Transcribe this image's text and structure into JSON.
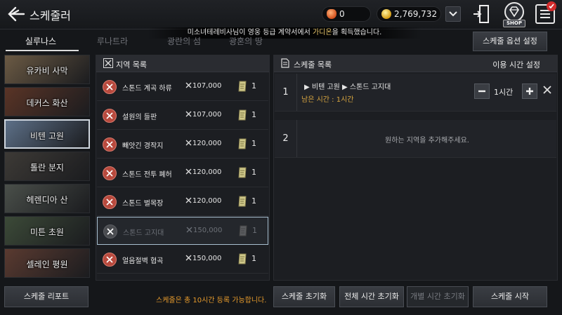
{
  "header": {
    "title": "스케줄러",
    "gems": "0",
    "gold": "2,769,732",
    "shop_label": "SHOP",
    "menu_badge": "3"
  },
  "notice": {
    "prefix": "미소녀테레비사님이 영웅 등급 계약서에서 ",
    "highlight": "가디온",
    "suffix": "을 획득했습니다."
  },
  "tabs": [
    {
      "label": "실루나스",
      "active": true
    },
    {
      "label": "루나트라",
      "active": false
    },
    {
      "label": "광란의 섬",
      "active": false
    },
    {
      "label": "광혼의 땅",
      "active": false
    }
  ],
  "options_button": "스케줄 옵션 설정",
  "regions": [
    {
      "label": "유카비 사막",
      "bg": "#6b5a44"
    },
    {
      "label": "데커스 화산",
      "bg": "#5a3426"
    },
    {
      "label": "비텐 고원",
      "bg": "#5d7088",
      "selected": true
    },
    {
      "label": "톨란 분지",
      "bg": "#3d3a36"
    },
    {
      "label": "헤렌디아 산",
      "bg": "#4a4f4a"
    },
    {
      "label": "미튼 초원",
      "bg": "#3c4a38"
    },
    {
      "label": "셀레인 평원",
      "bg": "#5a3a30"
    }
  ],
  "area_list": {
    "header": "지역 목록",
    "rows": [
      {
        "name": "스톤드 계곡 하류",
        "cost": "107,000",
        "count": "1"
      },
      {
        "name": "설원의 들판",
        "cost": "107,000",
        "count": "1"
      },
      {
        "name": "빼앗긴 경작지",
        "cost": "120,000",
        "count": "1"
      },
      {
        "name": "스톤드 전투 폐허",
        "cost": "120,000",
        "count": "1"
      },
      {
        "name": "스톤드 벌목장",
        "cost": "120,000",
        "count": "1"
      },
      {
        "name": "스톤드 고지대",
        "cost": "150,000",
        "count": "1",
        "disabled": true
      },
      {
        "name": "얼음절벽 협곡",
        "cost": "150,000",
        "count": "1"
      }
    ]
  },
  "schedule": {
    "header": "스케줄 목록",
    "time_header": "이용 시간 설정",
    "rows": [
      {
        "num": "1",
        "route": "▶ 비텐 고원 ▶ 스톤드 고지대",
        "remaining": "남은 시간 : 1시간",
        "hours": "1시간"
      },
      {
        "num": "2",
        "empty": "원하는 지역을 추가해주세요."
      }
    ]
  },
  "footer": {
    "report": "스케줄 리포트",
    "note": "스케줄은 총 10시간 등록 가능합니다.",
    "reset": "스케줄 초기화",
    "reset_all_time": "전체 시간 초기화",
    "reset_each_time": "개별 시간 초기화",
    "start": "스케줄 시작"
  },
  "colors": {
    "accent_orange": "#e59a2c",
    "emblem_red": "#b84a3e"
  }
}
